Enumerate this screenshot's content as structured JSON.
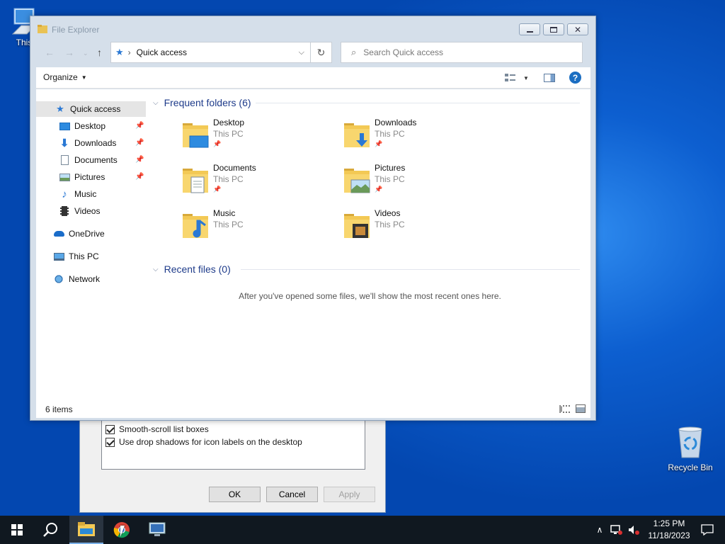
{
  "desktop": {
    "this_pc_label": "This",
    "recycle_bin_label": "Recycle Bin"
  },
  "perf_dialog": {
    "options": [
      {
        "label": "Smooth-scroll list boxes",
        "checked": true
      },
      {
        "label": "Use drop shadows for icon labels on the desktop",
        "checked": true
      }
    ],
    "ok_label": "OK",
    "cancel_label": "Cancel",
    "apply_label": "Apply"
  },
  "explorer": {
    "title": "File Explorer",
    "address": "Quick access",
    "search_placeholder": "Search Quick access",
    "organize_label": "Organize",
    "nav": {
      "quick_access": "Quick access",
      "pinned": [
        {
          "label": "Desktop",
          "icon": "desktop-icon"
        },
        {
          "label": "Downloads",
          "icon": "downloads-icon"
        },
        {
          "label": "Documents",
          "icon": "documents-icon"
        },
        {
          "label": "Pictures",
          "icon": "pictures-icon"
        }
      ],
      "unpinned": [
        {
          "label": "Music",
          "icon": "music-icon"
        },
        {
          "label": "Videos",
          "icon": "videos-icon"
        }
      ],
      "onedrive": "OneDrive",
      "this_pc": "This PC",
      "network": "Network"
    },
    "frequent_header": "Frequent folders (6)",
    "folders": [
      {
        "name": "Desktop",
        "location": "This PC",
        "pinned": true,
        "icon": "desktop-folder-icon"
      },
      {
        "name": "Downloads",
        "location": "This PC",
        "pinned": true,
        "icon": "downloads-folder-icon"
      },
      {
        "name": "Documents",
        "location": "This PC",
        "pinned": true,
        "icon": "documents-folder-icon"
      },
      {
        "name": "Pictures",
        "location": "This PC",
        "pinned": true,
        "icon": "pictures-folder-icon"
      },
      {
        "name": "Music",
        "location": "This PC",
        "pinned": false,
        "icon": "music-folder-icon"
      },
      {
        "name": "Videos",
        "location": "This PC",
        "pinned": false,
        "icon": "videos-folder-icon"
      }
    ],
    "recent_header": "Recent files (0)",
    "recent_empty": "After you've opened some files, we'll show the most recent ones here.",
    "status": "6 items"
  },
  "taskbar": {
    "time": "1:25 PM",
    "date": "11/18/2023"
  },
  "colors": {
    "accent": "#1e3b8a",
    "folder": "#f3c955",
    "taskbar": "#101820"
  }
}
